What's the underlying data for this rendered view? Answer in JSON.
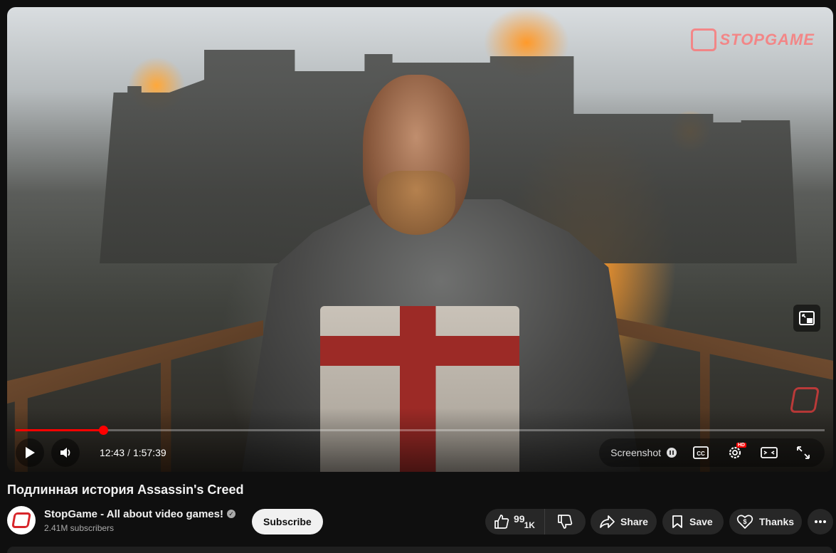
{
  "player": {
    "watermark": "STOPGAME",
    "progress": 0.108,
    "current_time": "12:43",
    "duration": "1:57:39",
    "time_separator": "/",
    "screenshot_label": "Screenshot",
    "controls": [
      "play-icon",
      "volume-icon",
      "pause-icon",
      "captions-icon",
      "settings-icon",
      "theater-icon",
      "fullscreen-icon",
      "miniplayer-icon"
    ],
    "cc_label": "CC",
    "hd_badge": "HD"
  },
  "video": {
    "title": "Подлинная история Assassin's Creed"
  },
  "channel": {
    "name": "StopGame - All about video games!",
    "subscribers": "2.41M subscribers",
    "verified_icon": "✓"
  },
  "actions": {
    "subscribe": "Subscribe",
    "like_count": "99",
    "like_suffix": "1K",
    "share": "Share",
    "save": "Save",
    "thanks": "Thanks",
    "more": "more-icon"
  },
  "colors": {
    "accent": "#ff0000",
    "background": "#0f0f0f",
    "pill": "#272727",
    "brand": "#d7262b"
  }
}
